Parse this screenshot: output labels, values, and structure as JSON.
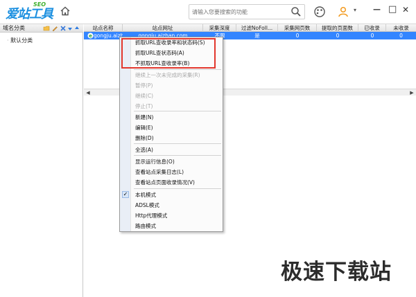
{
  "app": {
    "logo_text": "爱站工具包",
    "logo_seo": "SEO"
  },
  "toolbar": {
    "search_placeholder": "请输入您要搜索的功能",
    "minimize": "—",
    "maximize": "□",
    "close": "✕",
    "dropdown": "▾"
  },
  "left_panel": {
    "header": "域名分类",
    "items": [
      "默认分类"
    ]
  },
  "table": {
    "columns": [
      "站点名称",
      "站点网址",
      "采集深度",
      "过滤NoFoll...",
      "采集网页数",
      "提取的页面数",
      "已收录",
      "未收录"
    ],
    "rows": [
      {
        "name": "gongju.aizh...",
        "url": "gongju.aizhan.com",
        "depth": "不限",
        "nofollow": "是",
        "pages": "0",
        "extracted": "0",
        "indexed": "0",
        "unindexed": "0"
      }
    ]
  },
  "context_menu": {
    "items": [
      {
        "label": "抓取URL查收录率和状态码(S)",
        "disabled": false
      },
      {
        "label": "抓取URL查状态码(A)",
        "disabled": false
      },
      {
        "label": "不抓取URL查收录率(B)",
        "disabled": false
      },
      {
        "label": "继续上一次未完成的采集(R)",
        "disabled": true
      },
      {
        "label": "暂停(P)",
        "disabled": true
      },
      {
        "label": "继续(C)",
        "disabled": true
      },
      {
        "label": "停止(T)",
        "disabled": true
      },
      {
        "label": "新建(N)",
        "disabled": false
      },
      {
        "label": "编辑(E)",
        "disabled": false
      },
      {
        "label": "删除(D)",
        "disabled": false
      },
      {
        "label": "全选(A)",
        "disabled": false
      },
      {
        "label": "显示运行信息(O)",
        "disabled": false
      },
      {
        "label": "查看站点采集日志(L)",
        "disabled": false
      },
      {
        "label": "查看站点页面收录情况(V)",
        "disabled": false
      },
      {
        "label": "本机模式",
        "disabled": false,
        "checked": true
      },
      {
        "label": "ADSL模式",
        "disabled": false
      },
      {
        "label": "Http代理模式",
        "disabled": false
      },
      {
        "label": "路由模式",
        "disabled": false
      }
    ]
  },
  "watermark": "极速下载站",
  "colors": {
    "selection": "#3385ff",
    "highlight_box": "#e2362c",
    "logo_blue": "#1a8fe0",
    "logo_green": "#3fb12f"
  }
}
